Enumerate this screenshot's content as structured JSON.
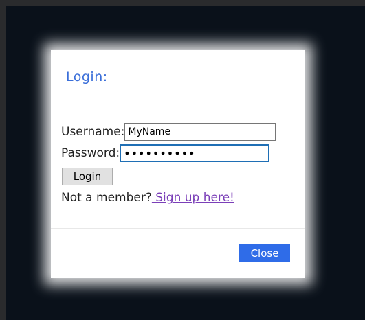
{
  "modal": {
    "title": "Login:",
    "username_label": "Username:",
    "username_value": "MyName",
    "password_label": "Password:",
    "password_value": "••••••••••",
    "login_button": "Login",
    "member_prompt": "Not a member?",
    "signup_link": " Sign up here!",
    "close_button": "Close"
  },
  "colors": {
    "title": "#3b6fd9",
    "close_button_bg": "#2f6ce8",
    "link": "#7b3fb8",
    "page_backdrop": "#0a111a"
  }
}
